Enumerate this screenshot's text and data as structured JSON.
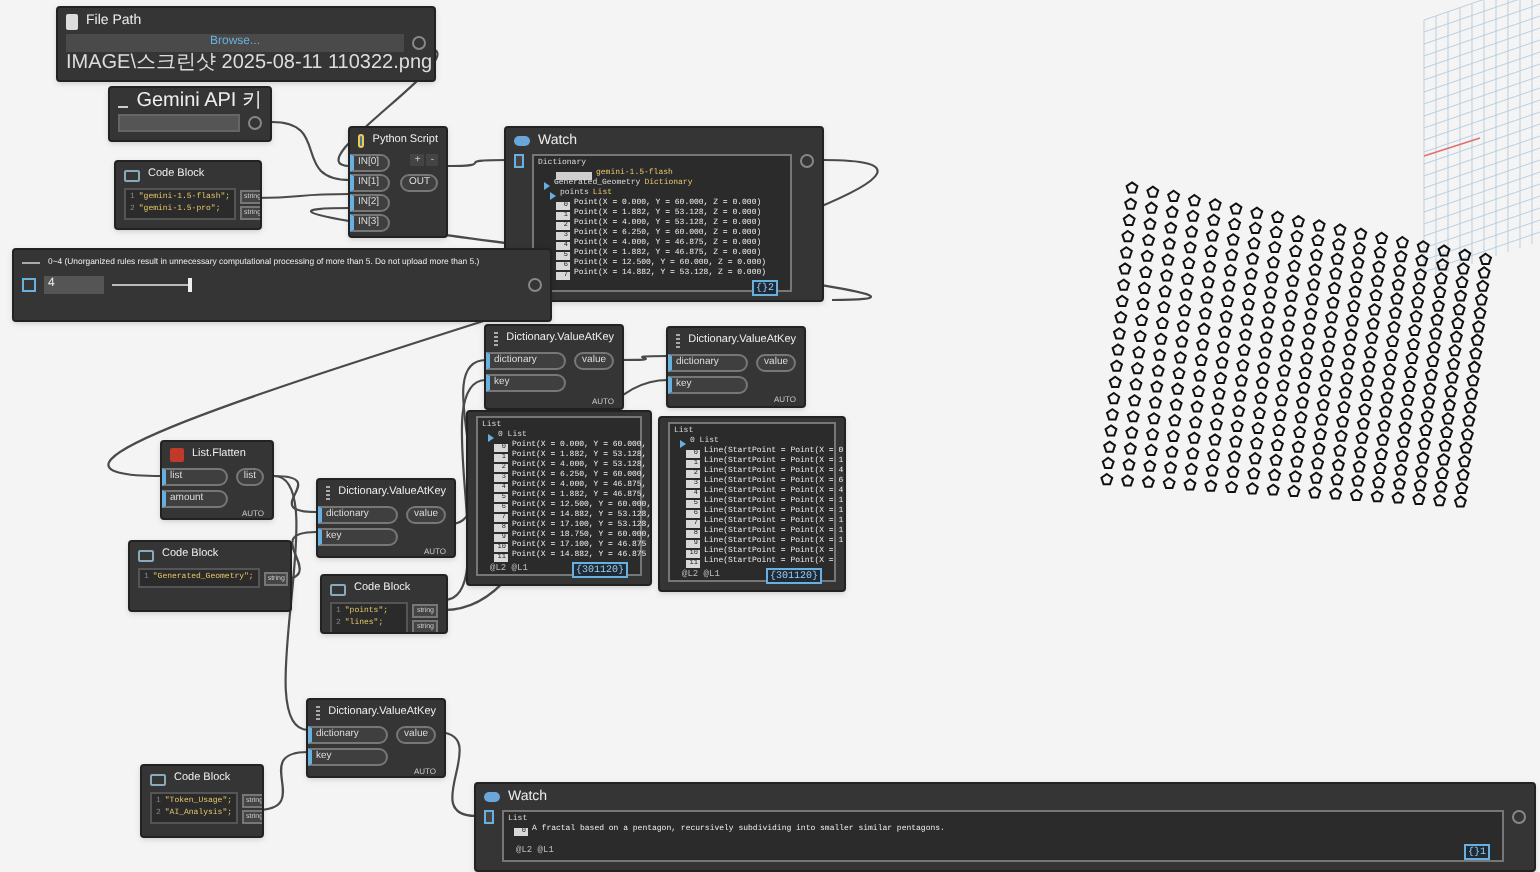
{
  "nodes": [
    {
      "kind": "file_path",
      "title": "File Path",
      "button": "Browse...",
      "value": "IMAGE\\스크린샷 2025-08-11 110322.png"
    },
    {
      "kind": "string_input",
      "title": "Gemini API 키"
    },
    {
      "kind": "code_block",
      "title": "Code Block",
      "lines": [
        {
          "number": "1",
          "code": "\"gemini-1.5-flash\";"
        },
        {
          "number": "2",
          "code": "\"gemini-1.5-pro\";"
        }
      ],
      "outputs": [
        "string",
        "string"
      ]
    },
    {
      "kind": "python",
      "title": "Python Script",
      "inputs": [
        "IN[0]",
        "IN[1]",
        "IN[2]",
        "IN[3]"
      ],
      "controls": [
        "+",
        "-"
      ],
      "output": "OUT"
    },
    {
      "kind": "watch",
      "title": "Watch",
      "tree": [
        {
          "kind": "group",
          "label": "Dictionary",
          "children": [
            {
              "kind": "key",
              "label": "gemini-1.5-flash"
            },
            {
              "kind": "group",
              "label": "Generated_Geometry",
              "type": "Dictionary",
              "children": [
                {
                  "kind": "group",
                  "label": "points",
                  "type": "List",
                  "children": [
                    {
                      "kind": "item",
                      "index": "0",
                      "label": "Point(X = 0.000, Y = 60.000, Z = 0.000)"
                    },
                    {
                      "kind": "item",
                      "index": "1",
                      "label": "Point(X = 1.882, Y = 53.128, Z = 0.000)"
                    },
                    {
                      "kind": "item",
                      "index": "2",
                      "label": "Point(X = 4.000, Y = 53.128, Z = 0.000)"
                    },
                    {
                      "kind": "item",
                      "index": "3",
                      "label": "Point(X = 6.250, Y = 60.000, Z = 0.000)"
                    },
                    {
                      "kind": "item",
                      "index": "4",
                      "label": "Point(X = 4.000, Y = 46.875, Z = 0.000)"
                    },
                    {
                      "kind": "item",
                      "index": "5",
                      "label": "Point(X = 1.882, Y = 46.875, Z = 0.000)"
                    },
                    {
                      "kind": "item",
                      "index": "6",
                      "label": "Point(X = 12.500, Y = 60.000, Z = 0.000)"
                    },
                    {
                      "kind": "item",
                      "index": "7",
                      "label": "Point(X = 14.882, Y = 53.128, Z = 0.000)"
                    }
                  ]
                }
              ]
            }
          ]
        }
      ],
      "footer": "{}2"
    },
    {
      "kind": "slider",
      "title": "0~4 (Unorganized rules result in unnecessary computational processing of more than 5. Do not upload more than 5.)",
      "value": "4",
      "level": 1
    },
    {
      "kind": "dict_value",
      "title": "Dictionary.ValueAtKey",
      "inputs": [
        "dictionary",
        "key"
      ],
      "output": "value",
      "lacing": "AUTO"
    },
    {
      "kind": "dict_value",
      "title": "Dictionary.ValueAtKey",
      "inputs": [
        "dictionary",
        "key"
      ],
      "output": "value",
      "lacing": "AUTO"
    },
    {
      "kind": "preview",
      "tree": [
        {
          "kind": "group",
          "label": "List",
          "children": [
            {
              "kind": "group",
              "label": "0 List",
              "children": [
                {
                  "kind": "item",
                  "index": "0",
                  "label": "Point(X = 0.000, Y = 60.000,"
                },
                {
                  "kind": "item",
                  "index": "1",
                  "label": "Point(X = 1.882, Y = 53.128,"
                },
                {
                  "kind": "item",
                  "index": "2",
                  "label": "Point(X = 4.000, Y = 53.128,"
                },
                {
                  "kind": "item",
                  "index": "3",
                  "label": "Point(X = 6.250, Y = 60.000,"
                },
                {
                  "kind": "item",
                  "index": "4",
                  "label": "Point(X = 4.000, Y = 46.875,"
                },
                {
                  "kind": "item",
                  "index": "5",
                  "label": "Point(X = 1.882, Y = 46.875,"
                },
                {
                  "kind": "item",
                  "index": "6",
                  "label": "Point(X = 12.500, Y = 60.000,"
                },
                {
                  "kind": "item",
                  "index": "7",
                  "label": "Point(X = 14.882, Y = 53.128,"
                },
                {
                  "kind": "item",
                  "index": "8",
                  "label": "Point(X = 17.100, Y = 53.128,"
                },
                {
                  "kind": "item",
                  "index": "9",
                  "label": "Point(X = 18.750, Y = 60.000,"
                },
                {
                  "kind": "item",
                  "index": "10",
                  "label": "Point(X = 17.100, Y = 46.875"
                },
                {
                  "kind": "item",
                  "index": "11",
                  "label": "Point(X = 14.882, Y = 46.875"
                }
              ]
            }
          ]
        }
      ],
      "levels": "@L2 @L1",
      "count": "{301120}"
    },
    {
      "kind": "preview",
      "tree": [
        {
          "kind": "group",
          "label": "List",
          "children": [
            {
              "kind": "group",
              "label": "0 List",
              "children": [
                {
                  "kind": "item",
                  "index": "0",
                  "label": "Line(StartPoint = Point(X = 0"
                },
                {
                  "kind": "item",
                  "index": "1",
                  "label": "Line(StartPoint = Point(X = 1"
                },
                {
                  "kind": "item",
                  "index": "2",
                  "label": "Line(StartPoint = Point(X = 4"
                },
                {
                  "kind": "item",
                  "index": "3",
                  "label": "Line(StartPoint = Point(X = 6"
                },
                {
                  "kind": "item",
                  "index": "4",
                  "label": "Line(StartPoint = Point(X = 4"
                },
                {
                  "kind": "item",
                  "index": "5",
                  "label": "Line(StartPoint = Point(X = 1"
                },
                {
                  "kind": "item",
                  "index": "6",
                  "label": "Line(StartPoint = Point(X = 1"
                },
                {
                  "kind": "item",
                  "index": "7",
                  "label": "Line(StartPoint = Point(X = 1"
                },
                {
                  "kind": "item",
                  "index": "8",
                  "label": "Line(StartPoint = Point(X = 1"
                },
                {
                  "kind": "item",
                  "index": "9",
                  "label": "Line(StartPoint = Point(X = 1"
                },
                {
                  "kind": "item",
                  "index": "10",
                  "label": "Line(StartPoint = Point(X ="
                },
                {
                  "kind": "item",
                  "index": "11",
                  "label": "Line(StartPoint = Point(X ="
                }
              ]
            }
          ]
        }
      ],
      "levels": "@L2 @L1",
      "count": "{301120}"
    },
    {
      "kind": "list_flatten",
      "title": "List.Flatten",
      "inputs": [
        "list",
        "amount"
      ],
      "output": "list",
      "lacing": "AUTO"
    },
    {
      "kind": "code_block",
      "title": "Code Block",
      "lines": [
        {
          "number": "1",
          "code": "\"Generated_Geometry\";"
        }
      ],
      "outputs": [
        "string"
      ]
    },
    {
      "kind": "dict_value",
      "title": "Dictionary.ValueAtKey",
      "inputs": [
        "dictionary",
        "key"
      ],
      "output": "value",
      "lacing": "AUTO"
    },
    {
      "kind": "code_block",
      "title": "Code Block",
      "lines": [
        {
          "number": "1",
          "code": "\"points\";"
        },
        {
          "number": "2",
          "code": "\"lines\";"
        }
      ],
      "outputs": [
        "string",
        "string"
      ]
    },
    {
      "kind": "dict_value",
      "title": "Dictionary.ValueAtKey",
      "inputs": [
        "dictionary",
        "key"
      ],
      "output": "value",
      "lacing": "AUTO"
    },
    {
      "kind": "code_block",
      "title": "Code Block",
      "lines": [
        {
          "number": "1",
          "code": "\"Token_Usage\";"
        },
        {
          "number": "2",
          "code": "\"AI_Analysis\";"
        }
      ],
      "outputs": [
        "string",
        "string"
      ]
    },
    {
      "kind": "watch",
      "title": "Watch",
      "tree": [
        {
          "kind": "group",
          "label": "List",
          "children": [
            {
              "kind": "item",
              "index": "0",
              "label": "A fractal based on a pentagon, recursively subdividing into smaller similar pentagons."
            }
          ]
        }
      ],
      "levels": "@L2 @L1",
      "footer": "{}1"
    }
  ]
}
